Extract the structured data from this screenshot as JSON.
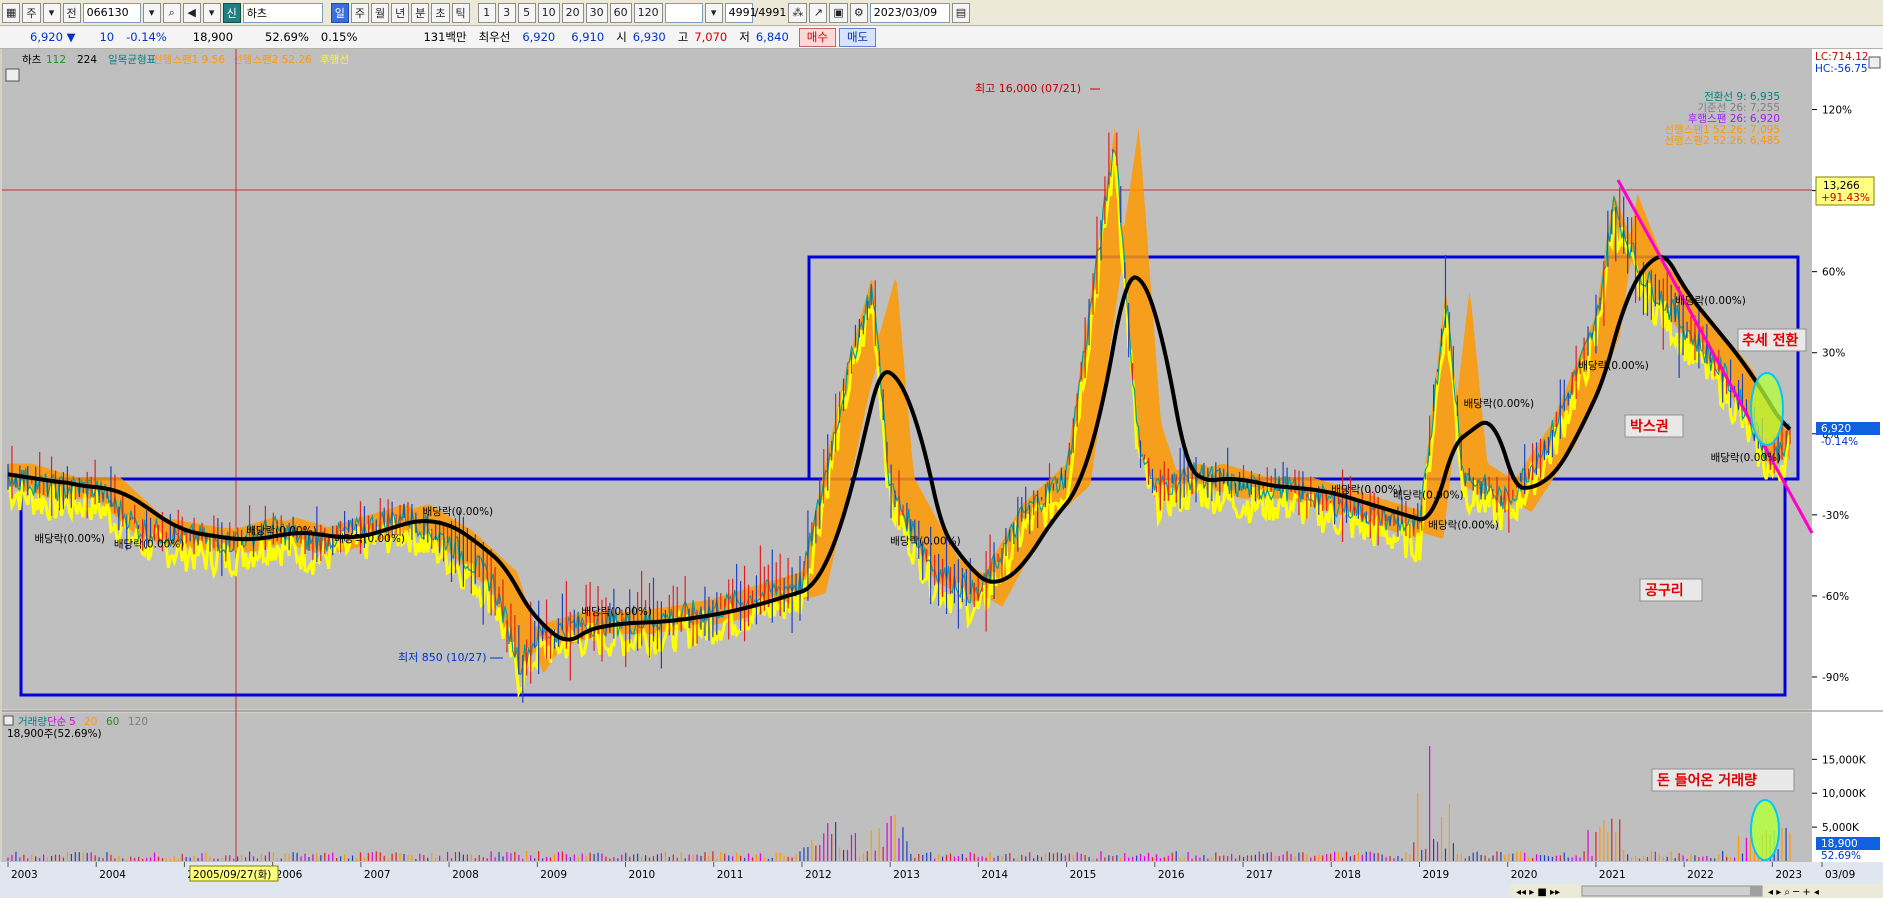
{
  "toolbar": {
    "period_buttons": [
      "일",
      "주",
      "월",
      "년",
      "분",
      "초",
      "틱"
    ],
    "active_period": "일",
    "interval_buttons": [
      "1",
      "3",
      "5",
      "10",
      "20",
      "30",
      "60",
      "120"
    ],
    "stock_code": "066130",
    "stock_name": "하츠",
    "market_tag": "신",
    "mode_label_1": "주",
    "mode_label_2": "전",
    "count_display": "4991",
    "count_total": "/4991",
    "date": "2023/03/09"
  },
  "quote": {
    "price": "6,920",
    "direction": "▼",
    "change": "10",
    "change_pct": "-0.14%",
    "volume": "18,900",
    "turnover_pct": "52.69%",
    "ratio": "0.15%",
    "amount": "131백만",
    "best_offer_label": "최우선",
    "ask": "6,920",
    "bid": "6,910",
    "open_label": "시",
    "open": "6,930",
    "high_label": "고",
    "high": "7,070",
    "low_label": "저",
    "low": "6,840",
    "buy_label": "매수",
    "sell_label": "매도"
  },
  "colors": {
    "price_candle": "#2040c0",
    "tenkan": "#00a0a0",
    "kijun": "#909090",
    "span1": "#ff9900",
    "span2": "#ffa500",
    "lagging": "#ffff00",
    "ma": "#000000",
    "box": "#0000dd",
    "trendline": "#ff00cc",
    "annotation_red": "#e00000",
    "ellipse_fill": "#b4ff3c",
    "ellipse_stroke": "#00c8ff"
  },
  "price_panel": {
    "legend": [
      {
        "text": "하츠",
        "color": "#000000"
      },
      {
        "text": "112",
        "color": "#2c8c2c"
      },
      {
        "text": "224",
        "color": "#000000"
      },
      {
        "text": "일목균형표",
        "color": "#008080"
      },
      {
        "text": "선행스팬1 9.56",
        "color": "#ff9900"
      },
      {
        "text": "선행스팬2 52.26",
        "color": "#ff9900"
      },
      {
        "text": "후행선",
        "color": "#ffff00"
      }
    ],
    "top_right_label_1": "LC:714.12",
    "top_right_label_2": "HC:-56.75",
    "ichimoku_values": [
      {
        "text": "전환선 9: 6,935",
        "color": "#008080"
      },
      {
        "text": "기준선 26: 7,255",
        "color": "#808080"
      },
      {
        "text": "후행스팬 26: 6,920",
        "color": "#a020f0"
      },
      {
        "text": "선행스팬1 52.26: 7,095",
        "color": "#ff9900"
      },
      {
        "text": "선행스팬2 52.26: 6,485",
        "color": "#ff9900"
      }
    ],
    "y_axis_labels": [
      "120%",
      "90%",
      "60%",
      "30%",
      "0%",
      "-30%",
      "-60%",
      "-90%"
    ],
    "y_range": [
      -100,
      135
    ],
    "crosshair_value": "13,266",
    "crosshair_pct": "+91.43%",
    "current_price_box": "6,920",
    "current_pct": "-0.14%",
    "high_annotation": "최고 16,000 (07/21)",
    "low_annotation": "최저 850 (10/27)",
    "dividend_labels": [
      "배당락(0.00%)",
      "배당락(0.00%)",
      "배당락(0.00%)",
      "배당락(0.00%)",
      "배당락(0.00%)",
      "배당락(0.00%)",
      "배당락(0.00%)",
      "배당락(0.00%)",
      "배당락(0.00%)",
      "배당락(0.00%)",
      "배당락(0.00%)",
      "배당락(0.00%)",
      "배당락(0.00%)",
      "배당락(0.00%)"
    ],
    "callout_trend": "추세 전환",
    "callout_box": "박스권",
    "callout_bottom": "공구리"
  },
  "volume_panel": {
    "legend": [
      {
        "text": "거래량",
        "color": "#008080"
      },
      {
        "text": "단순",
        "color": "#e000e0"
      },
      {
        "text": "5",
        "color": "#e000e0"
      },
      {
        "text": "20",
        "color": "#ff9900"
      },
      {
        "text": "60",
        "color": "#2c8c2c"
      },
      {
        "text": "120",
        "color": "#808080"
      }
    ],
    "sub_legend": "18,900주(52.69%)",
    "y_axis_labels": [
      "15,000K",
      "10,000K",
      "5,000K"
    ],
    "current_volume_box": "18,900",
    "current_volume_pct": "52.69%",
    "callout": "돈 들어온 거래량"
  },
  "x_axis": {
    "year_labels": [
      "2003",
      "2004",
      "2005",
      "2006",
      "2007",
      "2008",
      "2009",
      "2010",
      "2011",
      "2012",
      "2013",
      "2014",
      "2015",
      "2016",
      "2017",
      "2018",
      "2019",
      "2020",
      "2021",
      "2022",
      "2023",
      "03/09"
    ],
    "crosshair_date": "2005/09/27(화)"
  },
  "chart_data": {
    "type": "line",
    "title": "하츠",
    "x_label": "",
    "y_label": "",
    "y_unit": "%",
    "y_range": [
      -100,
      135
    ],
    "x": [
      2003,
      2003.5,
      2004,
      2004.5,
      2005,
      2005.5,
      2006,
      2006.5,
      2007,
      2007.5,
      2008,
      2008.5,
      2008.8,
      2009,
      2009.5,
      2010,
      2010.5,
      2011,
      2011.5,
      2012,
      2012.5,
      2012.8,
      2013,
      2013.5,
      2014,
      2014.5,
      2015,
      2015.55,
      2015.8,
      2016,
      2016.5,
      2017,
      2017.5,
      2018,
      2018.5,
      2019,
      2019.3,
      2019.5,
      2020,
      2020.5,
      2021,
      2021.2,
      2021.5,
      2022,
      2022.5,
      2023,
      2023.2
    ],
    "series": [
      {
        "name": "하츠",
        "values": [
          -15,
          -20,
          -20,
          -35,
          -38,
          -40,
          -35,
          -40,
          -35,
          -30,
          -40,
          -55,
          -85,
          -75,
          -70,
          -70,
          -68,
          -65,
          -60,
          -55,
          20,
          55,
          -20,
          -50,
          -60,
          -30,
          -15,
          110,
          0,
          -20,
          -15,
          -20,
          -20,
          -25,
          -30,
          -35,
          50,
          -15,
          -25,
          0,
          40,
          85,
          60,
          40,
          20,
          -10,
          0
        ]
      }
    ]
  }
}
